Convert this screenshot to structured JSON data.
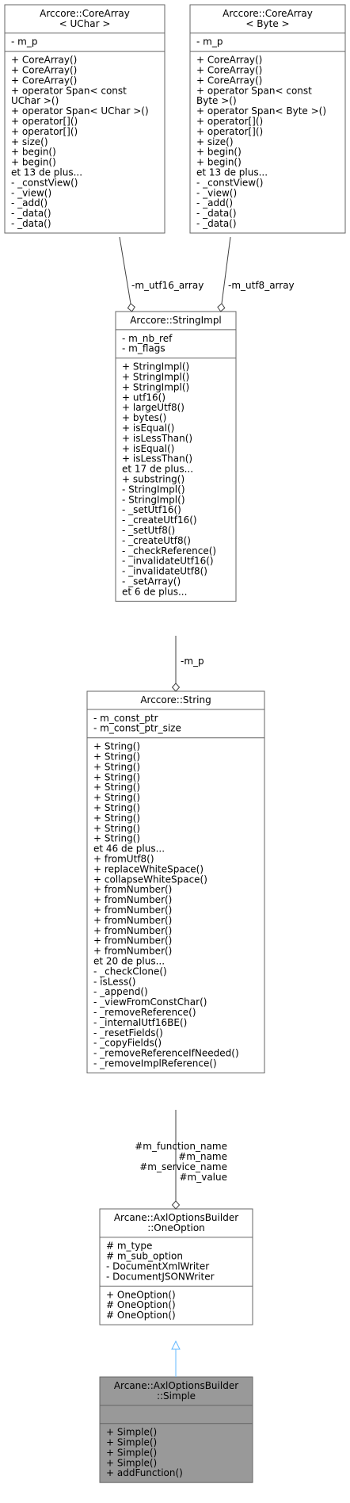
{
  "colors": {
    "box_border": "#666666",
    "box_fill": "#ffffff",
    "highlight_fill": "#999999",
    "edge": "#404040",
    "inherit_edge": "#63b8ff",
    "text": "#000000"
  },
  "classes": [
    {
      "id": "corearray_uchar",
      "title": [
        "Arccore::CoreArray",
        "< UChar >"
      ],
      "title_align": "middle",
      "highlight": false,
      "attributes": [
        "- m_p"
      ],
      "methods": [
        "+ CoreArray()",
        "+ CoreArray()",
        "+ CoreArray()",
        "+ operator Span< const",
        " UChar >()",
        "+ operator Span< UChar >()",
        "+ operator[]()",
        "+ operator[]()",
        "+ size()",
        "+ begin()",
        "+ begin()",
        "et 13 de plus...",
        "- _constView()",
        "- _view()",
        "- _add()",
        "- _data()",
        "- _data()"
      ]
    },
    {
      "id": "corearray_byte",
      "title": [
        "Arccore::CoreArray",
        "< Byte >"
      ],
      "title_align": "middle",
      "highlight": false,
      "attributes": [
        "- m_p"
      ],
      "methods": [
        "+ CoreArray()",
        "+ CoreArray()",
        "+ CoreArray()",
        "+ operator Span< const",
        " Byte >()",
        "+ operator Span< Byte >()",
        "+ operator[]()",
        "+ operator[]()",
        "+ size()",
        "+ begin()",
        "+ begin()",
        "et 13 de plus...",
        "- _constView()",
        "- _view()",
        "- _add()",
        "- _data()",
        "- _data()"
      ]
    },
    {
      "id": "stringimpl",
      "title": [
        "Arccore::StringImpl"
      ],
      "title_align": "middle",
      "highlight": false,
      "attributes": [
        "- m_nb_ref",
        "- m_flags"
      ],
      "methods": [
        "+ StringImpl()",
        "+ StringImpl()",
        "+ StringImpl()",
        "+ utf16()",
        "+ largeUtf8()",
        "+ bytes()",
        "+ isEqual()",
        "+ isLessThan()",
        "+ isEqual()",
        "+ isLessThan()",
        "et 17 de plus...",
        "+ substring()",
        "- StringImpl()",
        "- StringImpl()",
        "- _setUtf16()",
        "- _createUtf16()",
        "- _setUtf8()",
        "- _createUtf8()",
        "- _checkReference()",
        "- _invalidateUtf16()",
        "- _invalidateUtf8()",
        "- _setArray()",
        "et 6 de plus..."
      ]
    },
    {
      "id": "string",
      "title": [
        "Arccore::String"
      ],
      "title_align": "middle",
      "highlight": false,
      "attributes": [
        "- m_const_ptr",
        "- m_const_ptr_size"
      ],
      "methods": [
        "+ String()",
        "+ String()",
        "+ String()",
        "+ String()",
        "+ String()",
        "+ String()",
        "+ String()",
        "+ String()",
        "+ String()",
        "+ String()",
        "et 46 de plus...",
        "+ fromUtf8()",
        "+ replaceWhiteSpace()",
        "+ collapseWhiteSpace()",
        "+ fromNumber()",
        "+ fromNumber()",
        "+ fromNumber()",
        "+ fromNumber()",
        "+ fromNumber()",
        "+ fromNumber()",
        "+ fromNumber()",
        "et 20 de plus...",
        "- _checkClone()",
        "- isLess()",
        "- _append()",
        "- _viewFromConstChar()",
        "- _removeReference()",
        "- _internalUtf16BE()",
        "- _resetFields()",
        "- _copyFields()",
        "- _removeReferenceIfNeeded()",
        "- _removeImplReference()"
      ]
    },
    {
      "id": "oneoption",
      "title": [
        "Arcane::AxlOptionsBuilder",
        "::OneOption"
      ],
      "title_align": "middle",
      "highlight": false,
      "attributes": [
        "# m_type",
        "# m_sub_option",
        "- DocumentXmlWriter",
        "- DocumentJSONWriter"
      ],
      "methods": [
        "+ OneOption()",
        "# OneOption()",
        "# OneOption()"
      ]
    },
    {
      "id": "simple",
      "title": [
        "Arcane::AxlOptionsBuilder",
        "::Simple"
      ],
      "title_align": "middle",
      "highlight": true,
      "attributes": [],
      "methods": [
        "+ Simple()",
        "+ Simple()",
        "+ Simple()",
        "+ Simple()",
        "+ addFunction()"
      ]
    }
  ],
  "edges": [
    {
      "id": "utf16",
      "kind": "aggregation",
      "from": "corearray_uchar",
      "to": "stringimpl",
      "labels": [
        "-m_utf16_array"
      ]
    },
    {
      "id": "utf8",
      "kind": "aggregation",
      "from": "corearray_byte",
      "to": "stringimpl",
      "labels": [
        "-m_utf8_array"
      ]
    },
    {
      "id": "mp",
      "kind": "aggregation",
      "from": "stringimpl",
      "to": "string",
      "labels": [
        "-m_p"
      ]
    },
    {
      "id": "members",
      "kind": "aggregation",
      "from": "string",
      "to": "oneoption",
      "labels": [
        "#m_function_name",
        "#m_name",
        "#m_service_name",
        "#m_value"
      ]
    },
    {
      "id": "inherit",
      "kind": "inheritance",
      "from": "simple",
      "to": "oneoption",
      "labels": []
    }
  ]
}
